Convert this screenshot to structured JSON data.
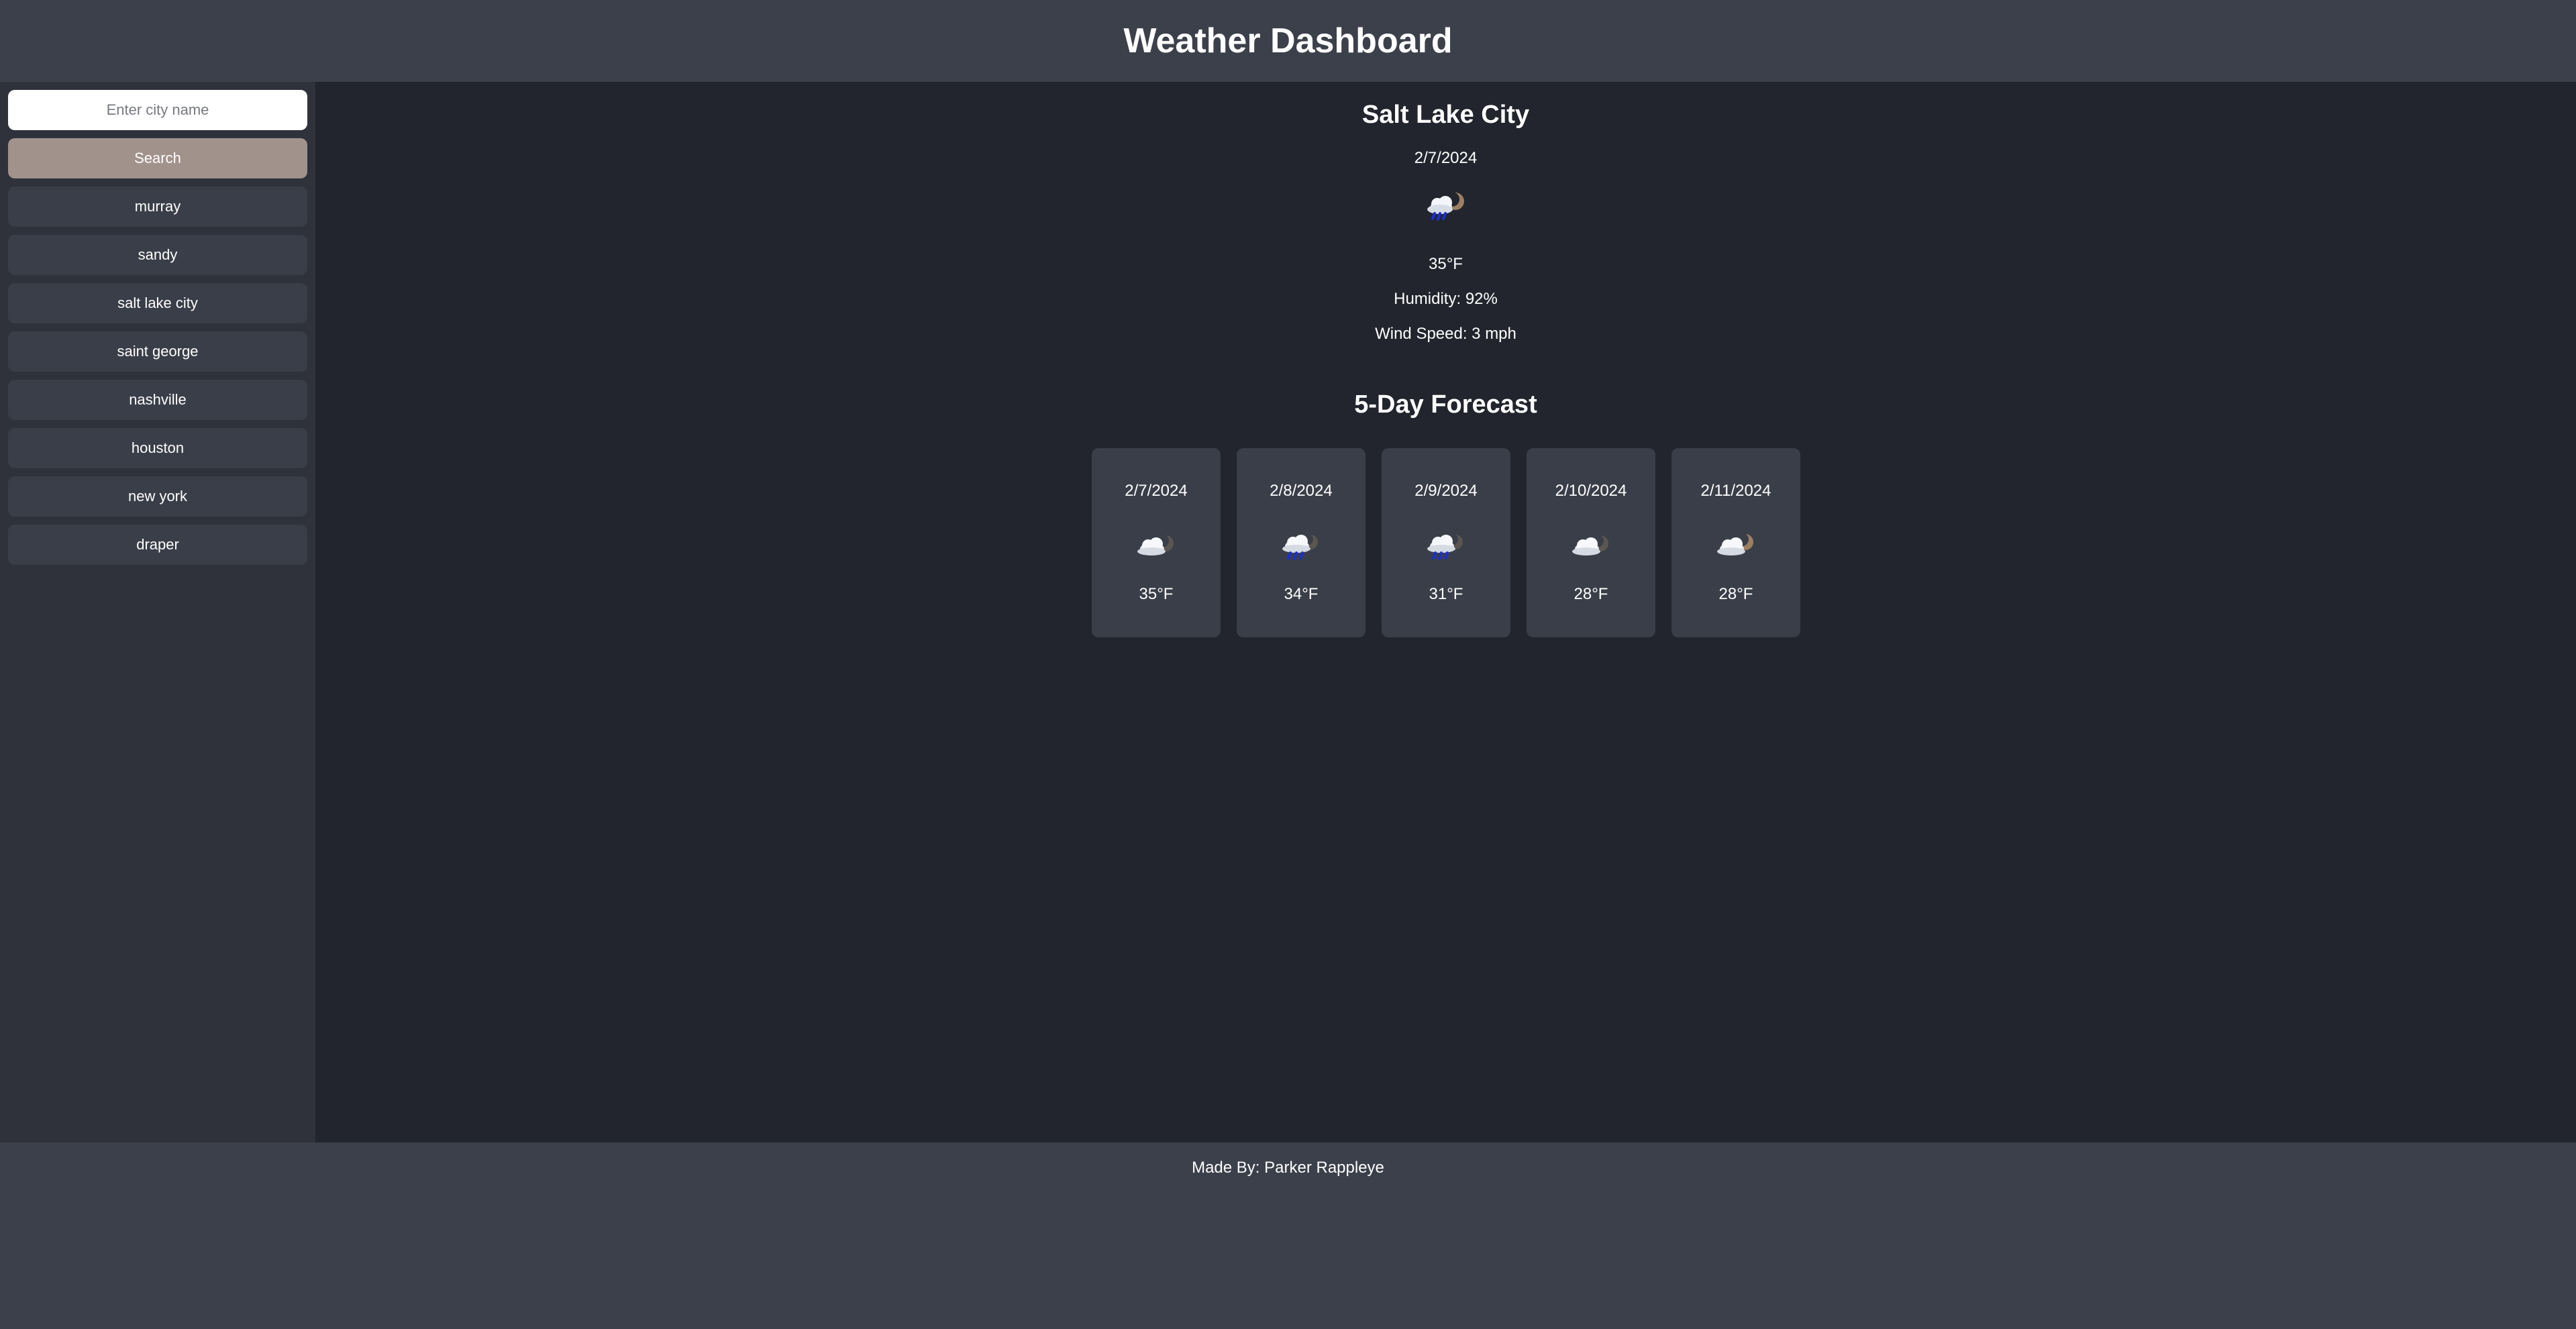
{
  "header": {
    "title": "Weather Dashboard"
  },
  "sidebar": {
    "search_placeholder": "Enter city name",
    "search_label": "Search",
    "history": [
      "murray",
      "sandy",
      "salt lake city",
      "saint george",
      "nashville",
      "houston",
      "new york",
      "draper"
    ]
  },
  "current": {
    "city": "Salt Lake City",
    "date": "2/7/2024",
    "icon": "rain-cloud-moon-icon",
    "temp": "35°F",
    "humidity": "Humidity: 92%",
    "wind": "Wind Speed: 3 mph"
  },
  "forecast": {
    "title": "5-Day Forecast",
    "days": [
      {
        "date": "2/7/2024",
        "icon": "cloud-moon-icon",
        "temp": "35°F"
      },
      {
        "date": "2/8/2024",
        "icon": "rain-cloud-moon-icon",
        "temp": "34°F"
      },
      {
        "date": "2/9/2024",
        "icon": "rain-cloud-moon-icon",
        "temp": "31°F"
      },
      {
        "date": "2/10/2024",
        "icon": "cloud-moon-icon",
        "temp": "28°F"
      },
      {
        "date": "2/11/2024",
        "icon": "cloud-moon-icon",
        "temp": "28°F"
      }
    ]
  },
  "footer": {
    "text": "Made By: Parker Rappleye"
  },
  "colors": {
    "header_bg": "#3c404b",
    "sidebar_bg": "#2f323b",
    "main_bg": "#22252d",
    "card_bg": "#3a3e48",
    "search_button": "#a2928c"
  }
}
